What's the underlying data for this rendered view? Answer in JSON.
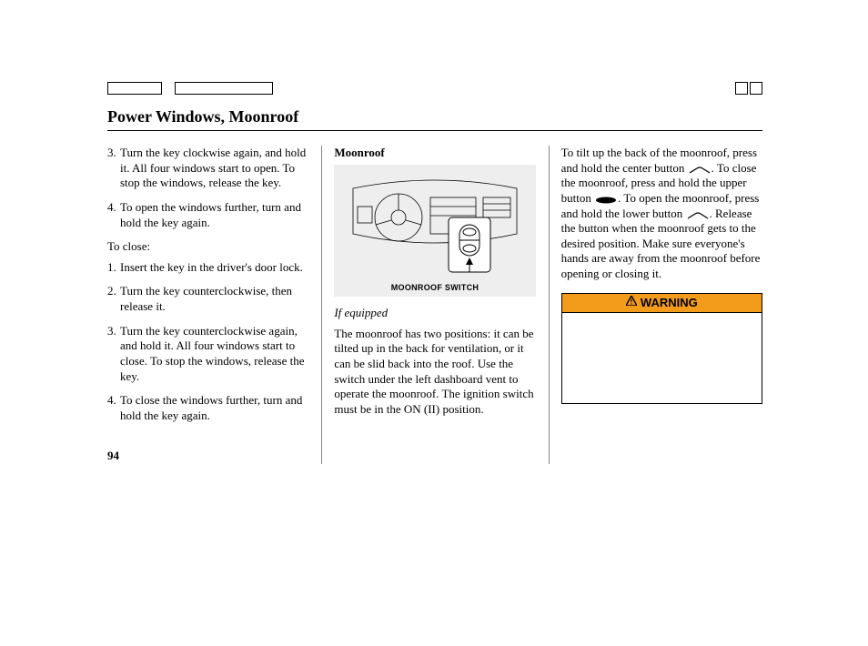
{
  "title": "Power Windows, Moonroof",
  "page_number": "94",
  "col1": {
    "open_steps": {
      "3": "Turn the key clockwise again, and hold it. All four windows start to open. To stop the windows, release the key.",
      "4": "To open the windows further, turn and hold the key again."
    },
    "close_heading": "To close:",
    "close_steps": {
      "1": "Insert the key in the driver's door lock.",
      "2": "Turn the key counterclockwise, then release it.",
      "3": "Turn the key counterclockwise again, and hold it. All four windows start to close. To stop the windows, release the key.",
      "4": "To close the windows further, turn and hold the key again."
    }
  },
  "col2": {
    "heading": "Moonroof",
    "figure_caption": "MOONROOF SWITCH",
    "if_equipped": "If equipped",
    "para": "The moonroof has two positions: it can be tilted up in the back for ventilation, or it can be slid back into the roof. Use the switch under the left dashboard vent to operate the moonroof. The ignition switch must be in the ON (II) position."
  },
  "col3": {
    "para_before_tilt_icon": "To tilt up the back of the moonroof, press and hold the center button",
    "para_after_tilt_icon_before_close_icon": ". To close the moonroof, press and hold the upper button ",
    "para_after_close_icon_before_open_icon": ". To open the moonroof, press and hold the lower button ",
    "para_after_open_icon": ". Release the button when the moonroof gets to the desired position. Make sure everyone's hands are away from the moonroof before opening or closing it.",
    "warning_label": "WARNING"
  }
}
